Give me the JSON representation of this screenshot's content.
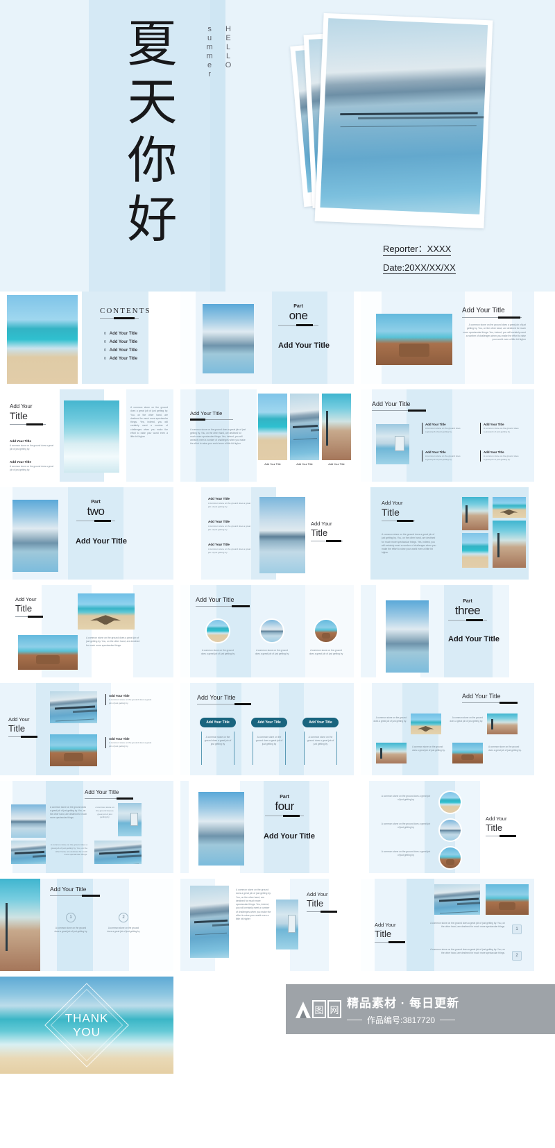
{
  "cover": {
    "title_cn": "夏天你好",
    "vertical_en_top": "HELLO",
    "vertical_en_bottom": "summer",
    "reporter": "Reporter：XXXX",
    "date": "Date:20XX/XX/XX"
  },
  "labels": {
    "add_your_title": "Add Your Title",
    "add_your": "Add Your",
    "title": "Title",
    "contents": "CONTENTS",
    "part": "Part",
    "thank_line1": "THANK",
    "thank_line2": "YOU"
  },
  "parts": [
    {
      "label": "Part",
      "num": "one"
    },
    {
      "label": "Part",
      "num": "two"
    },
    {
      "label": "Part",
      "num": "three"
    },
    {
      "label": "Part",
      "num": "four"
    }
  ],
  "body_copy": {
    "long": "A common stone on the ground does a great job of just getting by. You, on the other hand, are destined for much more spectacular things. Yes, indeed, you will certainly meet a number of challenges when you make the effort to raise your world even a little bit higher",
    "medium": "A common stone on the ground does a great job of just getting by. You, on the other hand, are destined for much more spectacular things.",
    "short": "A common stone on the ground does a great job of just getting by.",
    "tiny": "A common stone on the ground does a great job of just getting by"
  },
  "toc": [
    {
      "bullet": "0",
      "label": "Add Your Title"
    },
    {
      "bullet": "0",
      "label": "Add Your Title"
    },
    {
      "bullet": "0",
      "label": "Add Your Title"
    },
    {
      "bullet": "0",
      "label": "Add Your Title"
    }
  ],
  "numbers": {
    "one": "1",
    "two": "2"
  },
  "colors": {
    "page_bg": "#ffffff",
    "slide_bg": "#eaf4fb",
    "band": "#d5e9f5",
    "cover_bg": "#e8f3fa",
    "accent_pill": "#19647e",
    "text_dark": "#1c1c20",
    "text_body": "#7b8a96"
  },
  "watermark": {
    "logo_char1": "图",
    "logo_char2": "网",
    "tagline": "精品素材 · 每日更新",
    "work_id": "作品编号:3817720"
  }
}
